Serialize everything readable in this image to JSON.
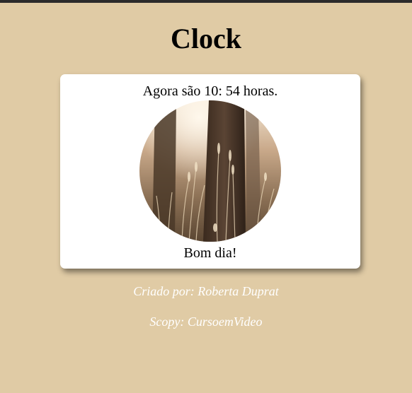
{
  "page": {
    "title": "Clock"
  },
  "card": {
    "time_message": "Agora são 10: 54 horas.",
    "greeting": "Bom dia!",
    "image_alt": "morning-field-photo"
  },
  "footer": {
    "author": "Criado por: Roberta Duprat",
    "scopy": "Scopy: CursoemVideo"
  },
  "colors": {
    "background": "#e0cba5",
    "card": "#ffffff",
    "footer_text": "#ffffff"
  }
}
